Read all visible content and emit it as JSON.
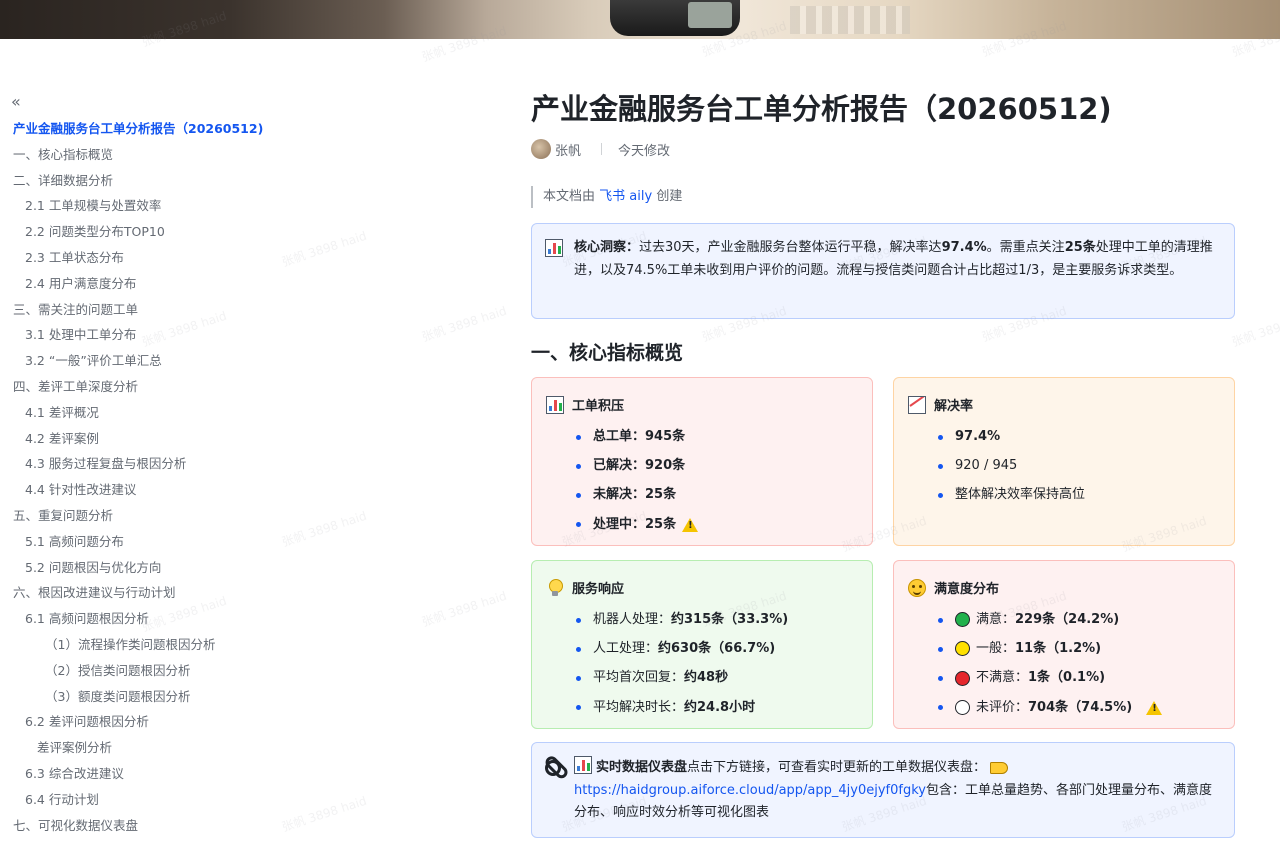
{
  "toc": {
    "collapse_icon": "double-chevron-left-icon",
    "items": [
      {
        "label": "产业金融服务台工单分析报告（20260512)",
        "level": 0,
        "active": true
      },
      {
        "label": "一、核心指标概览",
        "level": 0
      },
      {
        "label": "二、详细数据分析",
        "level": 0
      },
      {
        "label": "2.1 工单规模与处置效率",
        "level": 1
      },
      {
        "label": "2.2 问题类型分布TOP10",
        "level": 1
      },
      {
        "label": "2.3 工单状态分布",
        "level": 1
      },
      {
        "label": "2.4 用户满意度分布",
        "level": 1
      },
      {
        "label": "三、需关注的问题工单",
        "level": 0
      },
      {
        "label": "3.1 处理中工单分布",
        "level": 1
      },
      {
        "label": "3.2 “一般”评价工单汇总",
        "level": 1
      },
      {
        "label": "四、差评工单深度分析",
        "level": 0
      },
      {
        "label": "4.1 差评概况",
        "level": 1
      },
      {
        "label": "4.2 差评案例",
        "level": 1
      },
      {
        "label": "4.3 服务过程复盘与根因分析",
        "level": 1
      },
      {
        "label": "4.4 针对性改进建议",
        "level": 1
      },
      {
        "label": "五、重复问题分析",
        "level": 0
      },
      {
        "label": "5.1 高频问题分布",
        "level": 1
      },
      {
        "label": "5.2 问题根因与优化方向",
        "level": 1
      },
      {
        "label": "六、根因改进建议与行动计划",
        "level": 0
      },
      {
        "label": "6.1 高频问题根因分析",
        "level": 1
      },
      {
        "label": "（1）流程操作类问题根因分析",
        "level": 2
      },
      {
        "label": "（2）授信类问题根因分析",
        "level": 2
      },
      {
        "label": "（3）额度类问题根因分析",
        "level": 2
      },
      {
        "label": "6.2 差评问题根因分析",
        "level": 1
      },
      {
        "label": "差评案例分析",
        "level": 3
      },
      {
        "label": "6.3 综合改进建议",
        "level": 1
      },
      {
        "label": "6.4 行动计划",
        "level": 1
      },
      {
        "label": "七、可视化数据仪表盘",
        "level": 0
      }
    ]
  },
  "doc": {
    "title": "产业金融服务台工单分析报告（20260512)",
    "author": "张帆",
    "modified": "今天修改",
    "note_prefix": "本文档由",
    "note_link": "飞书 aily",
    "note_suffix": "创建"
  },
  "insight": {
    "label": "核心洞察：",
    "t1": "过去30天，产业金融服务台整体运行平稳，解决率达",
    "b1": "97.4%",
    "t2": "。需重点关注",
    "b2": "25条",
    "t3": "处理中工单的清理推进，以及74.5%工单未收到用户评价的问题。流程与授信类问题合计占比超过1/3，是主要服务诉求类型。"
  },
  "section1": {
    "heading": "一、核心指标概览"
  },
  "cards": {
    "backlog": {
      "title": "工单积压",
      "items": [
        "总工单：945条",
        "已解决：920条",
        "未解决：25条",
        "处理中：25条"
      ]
    },
    "rate": {
      "title": "解决率",
      "items": [
        "97.4%",
        "920 / 945",
        "整体解决效率保持高位"
      ]
    },
    "response": {
      "title": "服务响应",
      "items": [
        {
          "label": "机器人处理：",
          "value": "约315条（33.3%)"
        },
        {
          "label": "人工处理：",
          "value": "约630条（66.7%)"
        },
        {
          "label": "平均首次回复：",
          "value": "约48秒"
        },
        {
          "label": "平均解决时长：",
          "value": "约24.8小时"
        }
      ]
    },
    "satisfaction": {
      "title": "满意度分布",
      "items": [
        {
          "label": "满意：",
          "value": "229条（24.2%)",
          "color": "#22b14c"
        },
        {
          "label": "一般：",
          "value": "11条（1.2%)",
          "color": "#ffe000"
        },
        {
          "label": "不满意：",
          "value": "1条（0.1%)",
          "color": "#e5262c"
        },
        {
          "label": "未评价：",
          "value": "704条（74.5%)",
          "color": "#ffffff"
        }
      ]
    }
  },
  "dashboard": {
    "label": "实时数据仪表盘",
    "t1": "点击下方链接，可查看实时更新的工单数据仪表盘：",
    "url": "https://haidgroup.aiforce.cloud/app/app_4jy0ejyf0fgky",
    "t2": "包含：工单总量趋势、各部门处理量分布、满意度分布、响应时效分析等可视化图表"
  },
  "watermark": "张帆 3898 haid",
  "colors": {
    "accent": "#1456f0",
    "text": "#1f2329",
    "muted": "#646a73"
  }
}
